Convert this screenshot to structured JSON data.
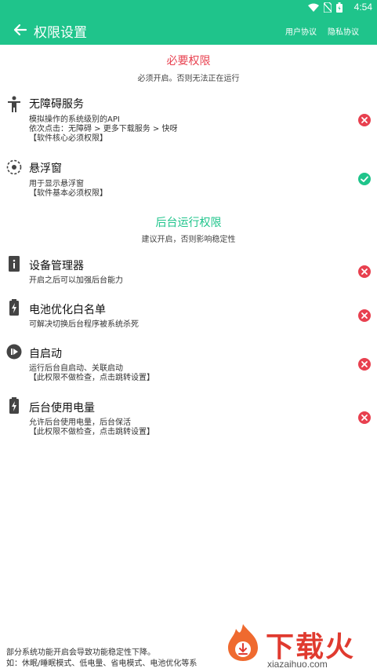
{
  "status_bar": {
    "time": "4:54"
  },
  "app_bar": {
    "title": "权限设置",
    "user_agreement": "用户协议",
    "privacy_agreement": "隐私协议"
  },
  "required": {
    "title": "必要权限",
    "subtitle": "必须开启。否则无法正在运行",
    "title_color": "#e8404f"
  },
  "accessibility": {
    "name": "无障碍服务",
    "desc": "模拟操作的系统级别的API\n依次点击：无障碍 > 更多下载服务 > 快呀\n【软件核心必须权限】",
    "status": "error"
  },
  "floating": {
    "name": "悬浮窗",
    "desc": "用于显示悬浮窗\n【软件基本必须权限】",
    "status": "ok"
  },
  "background": {
    "title": "后台运行权限",
    "subtitle": "建议开启，否则影响稳定性",
    "title_color": "#1fc48b"
  },
  "device_admin": {
    "name": "设备管理器",
    "desc": "开启之后可以加强后台能力",
    "status": "error"
  },
  "battery_whitelist": {
    "name": "电池优化白名单",
    "desc": "可解决切换后台程序被系统杀死",
    "status": "error"
  },
  "autostart": {
    "name": "自启动",
    "desc": "运行后台自启动、关联启动\n【此权限不做检查，点击跳转设置】",
    "status": "error"
  },
  "background_power": {
    "name": "后台使用电量",
    "desc": "允许后台使用电量，后台保活\n【此权限不做检查，点击跳转设置】",
    "status": "error"
  },
  "footer": {
    "text": "部分系统功能开启会导致功能稳定性下降。\n如：休眠/睡眠模式、低电量、省电模式、电池优化等系"
  },
  "watermark": {
    "brand": "下载火",
    "domain": "xiazaihuo.com"
  },
  "colors": {
    "primary": "#1fc48b",
    "error": "#e8404f"
  }
}
